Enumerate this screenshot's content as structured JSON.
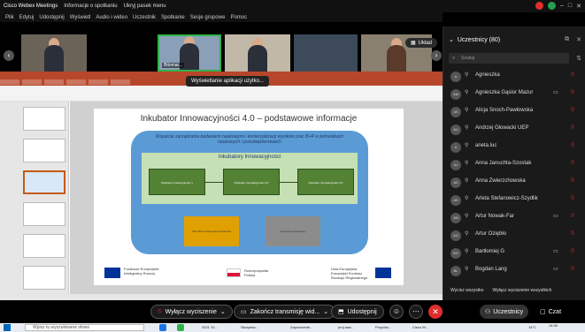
{
  "titlebar": {
    "app": "Cisco Webex Meetings",
    "items": [
      "Informacje o spotkaniu",
      "Ukryj pasek menu"
    ]
  },
  "menubar": [
    "Plik",
    "Edytuj",
    "Udostępnij",
    "Wyświetl",
    "Audio i wideo",
    "Uczestnik",
    "Spotkanie",
    "Sesje grupowe",
    "Pomoc"
  ],
  "videos": [
    {
      "name": "",
      "bg": "#6b6358"
    },
    {
      "name": "Bitomar...",
      "bg": "#8aa0b8"
    },
    {
      "name": "",
      "bg": "#c2b8a8"
    },
    {
      "name": "",
      "bg": "#3c4a5a"
    },
    {
      "name": "",
      "bg": "#8a8070"
    }
  ],
  "layout_button": "Układ",
  "tooltip": "Wyświetlanie aplikacji użytko...",
  "slide": {
    "title": "Inkubator Innowacyjności 4.0 – podstawowe informacje",
    "subtitle": "Wsparcie zarządzania badaniami naukowymi i komercjalizacji wyników prac B+R w jednostkach naukowych i przedsiębiorstwach",
    "panel_title": "Inkubatory Innowacyjności",
    "boxes": [
      "Inkubator Innowacyjności +",
      "Inkubator Innowacyjności 2.0",
      "Inkubator Innowacyjności 4.0"
    ],
    "yellow_box": "SIR UW innowacyjna współpraca",
    "gray_box": "ekonomia współpracy",
    "logos": {
      "fe": "Fundusze Europejskie",
      "fe_sub": "Inteligentny Rozwój",
      "rp": "Rzeczpospolita Polska",
      "ue": "Unia Europejska",
      "ue_sub": "Europejski Fundusz Rozwoju Regionalnego"
    }
  },
  "controls": {
    "mute_all": "Wyłącz wyciszenie",
    "stop_share": "Zakończ transmisję wid...",
    "share": "Udostępnij",
    "participants": "Uczestnicy",
    "chat": "Czat"
  },
  "panel": {
    "title": "Uczestnicy (80)",
    "search_placeholder": "Szukaj",
    "participants": [
      {
        "initials": "A",
        "name": "Agnieszka",
        "cam": false
      },
      {
        "initials": "AM",
        "name": "Agnieszka Gąsior Mazur",
        "cam": true
      },
      {
        "initials": "AS",
        "name": "Alicja Snoch-Pawłowska",
        "cam": false
      },
      {
        "initials": "AU",
        "name": "Andrzej Głowacki UEP",
        "cam": false
      },
      {
        "initials": "A",
        "name": "aneta.luc",
        "cam": false
      },
      {
        "initials": "AJ",
        "name": "Anna Januchta-Szostak",
        "cam": false
      },
      {
        "initials": "AZ",
        "name": "Anna Zwierzchowska",
        "cam": false
      },
      {
        "initials": "AS",
        "name": "Arleta Stefanowicz-Szydlik",
        "cam": false
      },
      {
        "initials": "AN",
        "name": "Artur Nowak-Far",
        "cam": true
      },
      {
        "initials": "AO",
        "name": "Artur Oziębło",
        "cam": false
      },
      {
        "initials": "BG",
        "name": "Bartłomiej G",
        "cam": true
      },
      {
        "initials": "BL",
        "name": "Bogdan Lang",
        "cam": true
      }
    ],
    "mute_all": "Wycisz wszystko",
    "unmute_all": "Wyłącz wyciszenie wszystkich"
  },
  "taskbar": {
    "search": "Wpisz tu wyszukiwane słowo",
    "apps": [
      "2021 10...",
      "Skrzynka...",
      "Zaproszenie...",
      "proj.stac...",
      "Przycisk...",
      "Cisco W..."
    ],
    "tray": "14°C",
    "time": "14:46"
  },
  "colors": {
    "ppt_red": "#b7472a",
    "leave_red": "#e02d2d",
    "slide_blue": "#5b9bd5",
    "slide_green": "#c5e0b4",
    "box_green": "#548235",
    "box_yellow": "#e0a100"
  }
}
